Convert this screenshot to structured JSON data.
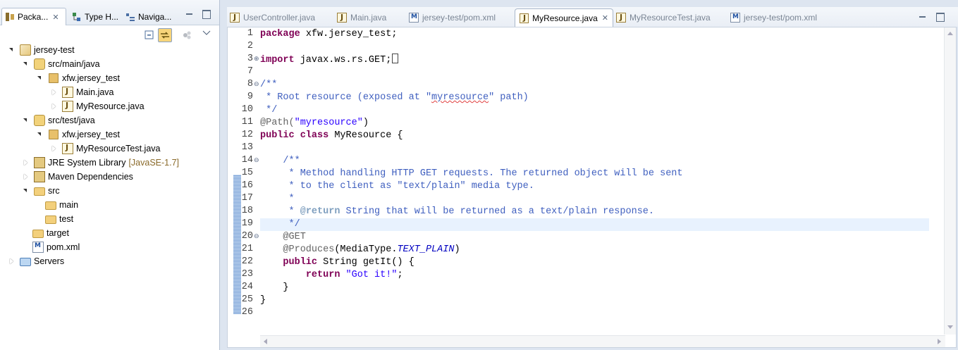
{
  "left_panel": {
    "tabs": [
      {
        "label": "Packa...",
        "icon": "package-explorer-icon",
        "active": true
      },
      {
        "label": "Type H...",
        "icon": "type-hierarchy-icon",
        "active": false
      },
      {
        "label": "Naviga...",
        "icon": "navigator-icon",
        "active": false
      }
    ],
    "tree": [
      {
        "label": "jersey-test",
        "icon": "maven-project-icon",
        "expanded": true
      },
      {
        "label": "src/main/java",
        "icon": "source-folder-icon",
        "expanded": true
      },
      {
        "label": "xfw.jersey_test",
        "icon": "package-icon",
        "expanded": true
      },
      {
        "label": "Main.java",
        "icon": "java-file-icon",
        "expanded": false
      },
      {
        "label": "MyResource.java",
        "icon": "java-file-icon",
        "expanded": false
      },
      {
        "label": "src/test/java",
        "icon": "source-folder-icon",
        "expanded": true
      },
      {
        "label": "xfw.jersey_test",
        "icon": "package-icon",
        "expanded": true
      },
      {
        "label": "MyResourceTest.java",
        "icon": "java-file-icon",
        "expanded": false
      },
      {
        "label": "JRE System Library",
        "decoration": "[JavaSE-1.7]",
        "icon": "library-icon",
        "expanded": false
      },
      {
        "label": "Maven Dependencies",
        "icon": "library-icon",
        "expanded": false
      },
      {
        "label": "src",
        "icon": "folder-icon",
        "expanded": true
      },
      {
        "label": "main",
        "icon": "folder-icon"
      },
      {
        "label": "test",
        "icon": "folder-icon"
      },
      {
        "label": "target",
        "icon": "folder-icon"
      },
      {
        "label": "pom.xml",
        "icon": "maven-xml-icon"
      },
      {
        "label": "Servers",
        "icon": "servers-folder-icon",
        "expanded": false
      }
    ]
  },
  "editor": {
    "tabs": [
      {
        "label": "UserController.java",
        "icon": "java-file-icon",
        "active": false
      },
      {
        "label": "Main.java",
        "icon": "java-file-icon",
        "active": false
      },
      {
        "label": "jersey-test/pom.xml",
        "icon": "maven-xml-icon",
        "active": false
      },
      {
        "label": "MyResource.java",
        "icon": "java-file-icon",
        "active": true
      },
      {
        "label": "MyResourceTest.java",
        "icon": "java-file-icon",
        "active": false
      },
      {
        "label": "jersey-test/pom.xml",
        "icon": "maven-xml-icon",
        "active": false
      }
    ],
    "line_numbers": [
      "1",
      "2",
      "3",
      "7",
      "8",
      "9",
      "10",
      "11",
      "12",
      "13",
      "14",
      "15",
      "16",
      "17",
      "18",
      "19",
      "20",
      "21",
      "22",
      "23",
      "24",
      "25",
      "26"
    ],
    "current_line": "19",
    "code": {
      "l1_kw": "package",
      "l1_rest": " xfw.jersey_test;",
      "l3_kw": "import",
      "l3_rest": " javax.ws.rs.GET;",
      "l8": "/**",
      "l9_a": " * Root resource (exposed at \"",
      "l9_b": "myresource",
      "l9_c": "\" path)",
      "l10": " */",
      "l11_ann": "@Path(",
      "l11_str": "\"myresource\"",
      "l11_end": ")",
      "l12_kw": "public class",
      "l12_rest": " MyResource {",
      "l14": "    /**",
      "l15": "     * Method handling HTTP GET requests. The returned object will be sent",
      "l16": "     * to the client as \"text/plain\" media type.",
      "l17": "     *",
      "l18_a": "     * ",
      "l18_tag": "@return",
      "l18_b": " String that will be returned as a text/plain response.",
      "l19": "     */",
      "l20": "    @GET",
      "l21_a": "    @Produces",
      "l21_b": "(MediaType.",
      "l21_c": "TEXT_PLAIN",
      "l21_d": ")",
      "l22_pad": "    ",
      "l22_kw": "public",
      "l22_rest": " String getIt() {",
      "l23_pad": "        ",
      "l23_kw": "return",
      "l23_str": " \"Got it!\"",
      "l23_end": ";",
      "l24": "    }",
      "l25": "}"
    }
  }
}
